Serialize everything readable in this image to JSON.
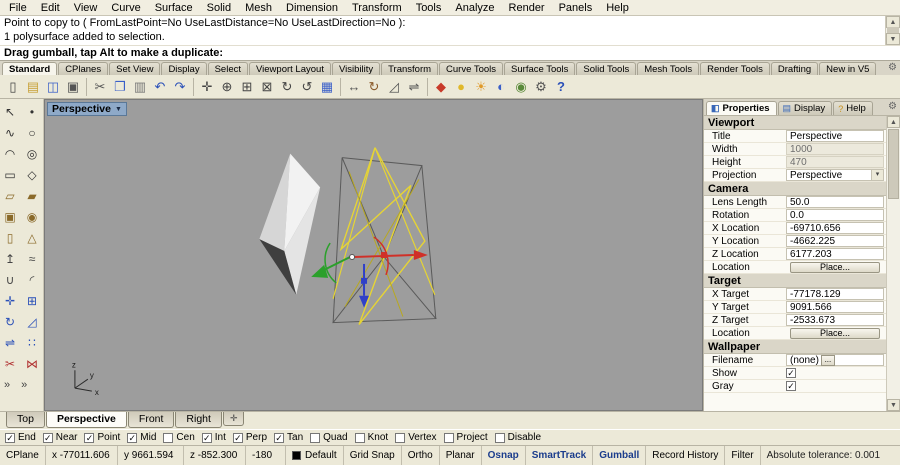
{
  "colors": {
    "chrome": "#ece9d8",
    "viewport_bg": "#9d9d9d",
    "gumball_red": "#d03028",
    "gumball_green": "#2ba02b",
    "gumball_blue": "#3040c8",
    "selection_yellow": "#e6d434",
    "wire_gray": "#5a5a5a",
    "active_text": "#1a3c8c"
  },
  "menu": {
    "items": [
      "File",
      "Edit",
      "View",
      "Curve",
      "Surface",
      "Solid",
      "Mesh",
      "Dimension",
      "Transform",
      "Tools",
      "Analyze",
      "Render",
      "Panels",
      "Help"
    ]
  },
  "command": {
    "history_line1": "Point to copy to ( FromLastPoint=No  UseLastDistance=No  UseLastDirection=No ):",
    "history_line2": "1 polysurface added to selection.",
    "prompt": "Drag gumball, tap Alt to make a duplicate:"
  },
  "toolbar_tabs": {
    "active": "Standard",
    "items": [
      "Standard",
      "CPlanes",
      "Set View",
      "Display",
      "Select",
      "Viewport Layout",
      "Visibility",
      "Transform",
      "Curve Tools",
      "Surface Tools",
      "Solid Tools",
      "Mesh Tools",
      "Render Tools",
      "Drafting",
      "New in V5"
    ]
  },
  "toolbar": {
    "icons": [
      {
        "name": "new-file-icon",
        "glyph": "▯",
        "color": "#444444"
      },
      {
        "name": "open-file-icon",
        "glyph": "▤",
        "color": "#c8a23a"
      },
      {
        "name": "save-icon",
        "glyph": "◫",
        "color": "#3a5fc8"
      },
      {
        "name": "print-icon",
        "glyph": "▣",
        "color": "#555555"
      },
      {
        "sep": true
      },
      {
        "name": "cut-icon",
        "glyph": "✂",
        "color": "#555555"
      },
      {
        "name": "copy-icon",
        "glyph": "❐",
        "color": "#3a5fc8"
      },
      {
        "name": "paste-icon",
        "glyph": "▥",
        "color": "#777777"
      },
      {
        "name": "undo-icon",
        "glyph": "↶",
        "color": "#2a50b8"
      },
      {
        "name": "redo-icon",
        "glyph": "↷",
        "color": "#2a50b8"
      },
      {
        "sep": true
      },
      {
        "name": "pan-view-icon",
        "glyph": "✛",
        "color": "#444444"
      },
      {
        "name": "zoom-dynamic-icon",
        "glyph": "⊕",
        "color": "#444444"
      },
      {
        "name": "zoom-window-icon",
        "glyph": "⊞",
        "color": "#444444"
      },
      {
        "name": "zoom-extents-icon",
        "glyph": "⊠",
        "color": "#444444"
      },
      {
        "name": "rotate-view-icon",
        "glyph": "↻",
        "color": "#444444"
      },
      {
        "name": "undo-view-icon",
        "glyph": "↺",
        "color": "#444444"
      },
      {
        "name": "four-viewports-icon",
        "glyph": "▦",
        "color": "#3a5fc8"
      },
      {
        "sep": true
      },
      {
        "name": "move-icon",
        "glyph": "↔",
        "color": "#555555"
      },
      {
        "name": "rotate-icon",
        "glyph": "↻",
        "color": "#8a5a2a"
      },
      {
        "name": "scale-icon",
        "glyph": "◿",
        "color": "#555555"
      },
      {
        "name": "mirror-icon",
        "glyph": "⇌",
        "color": "#555555"
      },
      {
        "sep": true
      },
      {
        "name": "render-icon",
        "glyph": "◆",
        "color": "#c83a2a"
      },
      {
        "name": "render-preview-icon",
        "glyph": "●",
        "color": "#e0b82a"
      },
      {
        "name": "light-icon",
        "glyph": "☀",
        "color": "#e09a2a"
      },
      {
        "name": "material-editor-icon",
        "glyph": "◐",
        "color": "#3a5fc8"
      },
      {
        "name": "shaded-viewport-icon",
        "glyph": "◉",
        "color": "#5a8a3a"
      },
      {
        "name": "options-icon",
        "glyph": "⚙",
        "color": "#555555"
      },
      {
        "name": "help-icon",
        "glyph": "?",
        "color": "#2a50b8"
      }
    ]
  },
  "sidebar": {
    "icons": [
      {
        "name": "select-pointer-icon",
        "glyph": "↖",
        "color": "#333333"
      },
      {
        "name": "point-icon",
        "glyph": "•",
        "color": "#333333"
      },
      {
        "name": "curve-icon",
        "glyph": "∿",
        "color": "#333333"
      },
      {
        "name": "circle-icon",
        "glyph": "○",
        "color": "#333333"
      },
      {
        "name": "arc-icon",
        "glyph": "◠",
        "color": "#333333"
      },
      {
        "name": "ellipse-icon",
        "glyph": "◎",
        "color": "#333333"
      },
      {
        "name": "rectangle-icon",
        "glyph": "▭",
        "color": "#333333"
      },
      {
        "name": "polygon-icon",
        "glyph": "◇",
        "color": "#333333"
      },
      {
        "name": "surface-icon",
        "glyph": "▱",
        "color": "#8a6a2a"
      },
      {
        "name": "plane-icon",
        "glyph": "▰",
        "color": "#8a6a2a"
      },
      {
        "name": "box-icon",
        "glyph": "▣",
        "color": "#8a6a2a"
      },
      {
        "name": "sphere-icon",
        "glyph": "◉",
        "color": "#8a6a2a"
      },
      {
        "name": "cylinder-icon",
        "glyph": "▯",
        "color": "#8a6a2a"
      },
      {
        "name": "cone-icon",
        "glyph": "△",
        "color": "#8a6a2a"
      },
      {
        "name": "extrude-icon",
        "glyph": "↥",
        "color": "#444444"
      },
      {
        "name": "loft-icon",
        "glyph": "≈",
        "color": "#444444"
      },
      {
        "name": "boolean-icon",
        "glyph": "∪",
        "color": "#444444"
      },
      {
        "name": "fillet-icon",
        "glyph": "◜",
        "color": "#444444"
      },
      {
        "name": "move-tool-icon",
        "glyph": "✛",
        "color": "#2a50b8"
      },
      {
        "name": "copy-tool-icon",
        "glyph": "⊞",
        "color": "#2a50b8"
      },
      {
        "name": "rotate-tool-icon",
        "glyph": "↻",
        "color": "#2a50b8"
      },
      {
        "name": "scale-tool-icon",
        "glyph": "◿",
        "color": "#2a50b8"
      },
      {
        "name": "mirror-tool-icon",
        "glyph": "⇌",
        "color": "#2a50b8"
      },
      {
        "name": "array-icon",
        "glyph": "∷",
        "color": "#2a50b8"
      },
      {
        "name": "trim-icon",
        "glyph": "✂",
        "color": "#b03030"
      },
      {
        "name": "join-icon",
        "glyph": "⋈",
        "color": "#b03030"
      }
    ],
    "overflow_chevrons": "» »"
  },
  "viewport": {
    "label": "Perspective"
  },
  "panel": {
    "tabs": [
      {
        "label": "Properties",
        "icon": "◧",
        "icon_color": "#3a68b8",
        "active": true
      },
      {
        "label": "Display",
        "icon": "▤",
        "icon_color": "#3a68b8",
        "active": false
      },
      {
        "label": "Help",
        "icon": "?",
        "icon_color": "#c89018",
        "active": false
      }
    ],
    "rows": [
      {
        "type": "header",
        "label": "Viewport"
      },
      {
        "type": "text",
        "label": "Title",
        "value": "Perspective"
      },
      {
        "type": "disabled",
        "label": "Width",
        "value": "1000"
      },
      {
        "type": "disabled",
        "label": "Height",
        "value": "470"
      },
      {
        "type": "dropdown",
        "label": "Projection",
        "value": "Perspective"
      },
      {
        "type": "header",
        "label": "Camera"
      },
      {
        "type": "text",
        "label": "Lens Length",
        "value": "50.0"
      },
      {
        "type": "text",
        "label": "Rotation",
        "value": "0.0"
      },
      {
        "type": "text",
        "label": "X Location",
        "value": "-69710.656"
      },
      {
        "type": "text",
        "label": "Y Location",
        "value": "-4662.225"
      },
      {
        "type": "text",
        "label": "Z Location",
        "value": "6177.203"
      },
      {
        "type": "button",
        "label": "Location",
        "value": "Place..."
      },
      {
        "type": "header",
        "label": "Target"
      },
      {
        "type": "text",
        "label": "X Target",
        "value": "-77178.129"
      },
      {
        "type": "text",
        "label": "Y Target",
        "value": "9091.566"
      },
      {
        "type": "text",
        "label": "Z Target",
        "value": "-2533.673"
      },
      {
        "type": "button",
        "label": "Location",
        "value": "Place..."
      },
      {
        "type": "header",
        "label": "Wallpaper"
      },
      {
        "type": "file",
        "label": "Filename",
        "value": "(none)",
        "button": "..."
      },
      {
        "type": "check",
        "label": "Show",
        "checked": true
      },
      {
        "type": "check",
        "label": "Gray",
        "checked": true
      }
    ]
  },
  "viewport_tabs": {
    "items": [
      {
        "label": "Top",
        "active": false
      },
      {
        "label": "Perspective",
        "active": true
      },
      {
        "label": "Front",
        "active": false
      },
      {
        "label": "Right",
        "active": false
      },
      {
        "label": "✛",
        "active": false,
        "icon": true
      }
    ]
  },
  "osnap": {
    "items": [
      {
        "label": "End",
        "checked": true
      },
      {
        "label": "Near",
        "checked": true
      },
      {
        "label": "Point",
        "checked": true
      },
      {
        "label": "Mid",
        "checked": true
      },
      {
        "label": "Cen",
        "checked": false
      },
      {
        "label": "Int",
        "checked": true
      },
      {
        "label": "Perp",
        "checked": true
      },
      {
        "label": "Tan",
        "checked": true
      },
      {
        "label": "Quad",
        "checked": false
      },
      {
        "label": "Knot",
        "checked": false
      },
      {
        "label": "Vertex",
        "checked": false
      },
      {
        "label": "Project",
        "checked": false
      },
      {
        "label": "Disable",
        "checked": false
      }
    ]
  },
  "statusbar": {
    "cplane_label": "CPlane",
    "x": "x -77011.606",
    "y": "y 9661.594",
    "z": "z -852.300",
    "angle": "-180",
    "layer": "Default",
    "layer_color": "#000000",
    "toggles": [
      {
        "label": "Grid Snap",
        "active": false
      },
      {
        "label": "Ortho",
        "active": false
      },
      {
        "label": "Planar",
        "active": false
      },
      {
        "label": "Osnap",
        "active": true
      },
      {
        "label": "SmartTrack",
        "active": true
      },
      {
        "label": "Gumball",
        "active": true
      },
      {
        "label": "Record History",
        "active": false
      },
      {
        "label": "Filter",
        "active": false
      }
    ],
    "tolerance": "Absolute tolerance: 0.001"
  },
  "scrollbar": {
    "up": "▲",
    "down": "▼"
  }
}
